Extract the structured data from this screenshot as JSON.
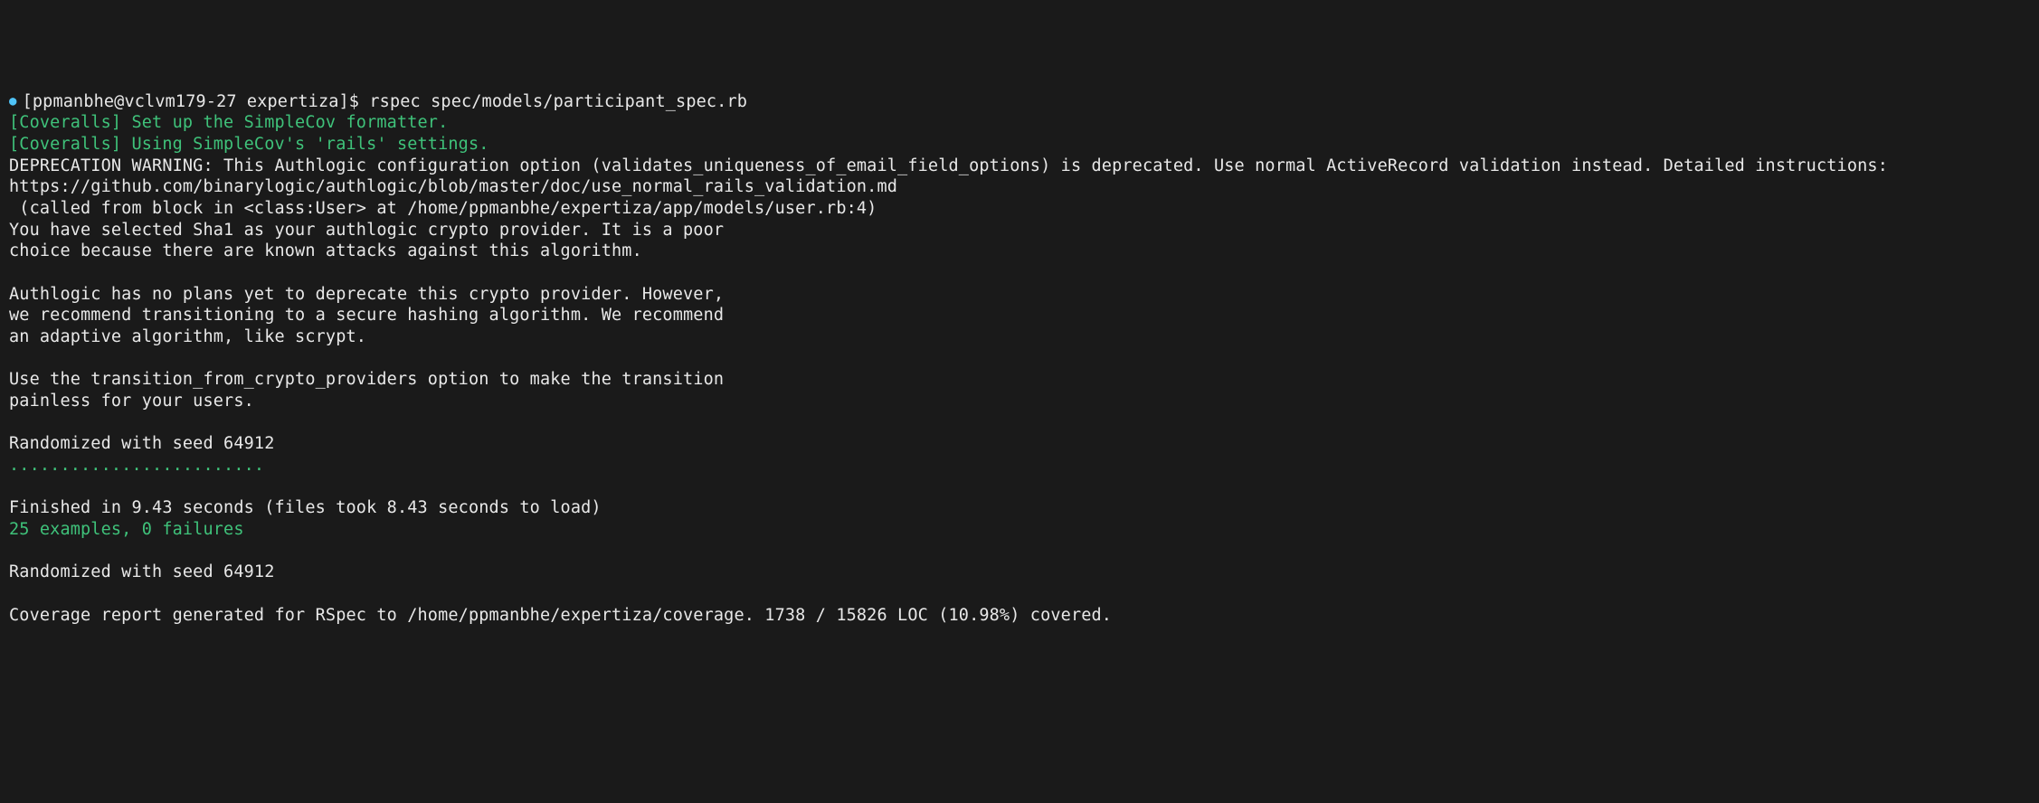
{
  "terminal": {
    "bullet": "●",
    "prompt": "[ppmanbhe@vclvm179-27 expertiza]$ ",
    "command": "rspec spec/models/participant_spec.rb",
    "lines": [
      {
        "cls": "green",
        "text": "[Coveralls] Set up the SimpleCov formatter."
      },
      {
        "cls": "green",
        "text": "[Coveralls] Using SimpleCov's 'rails' settings."
      },
      {
        "cls": "white",
        "text": "DEPRECATION WARNING: This Authlogic configuration option (validates_uniqueness_of_email_field_options) is deprecated. Use normal ActiveRecord validation instead. Detailed instructions:"
      },
      {
        "cls": "white",
        "text": "https://github.com/binarylogic/authlogic/blob/master/doc/use_normal_rails_validation.md"
      },
      {
        "cls": "white",
        "text": " (called from block in <class:User> at /home/ppmanbhe/expertiza/app/models/user.rb:4)"
      },
      {
        "cls": "white",
        "text": "You have selected Sha1 as your authlogic crypto provider. It is a poor"
      },
      {
        "cls": "white",
        "text": "choice because there are known attacks against this algorithm."
      },
      {
        "cls": "white",
        "text": ""
      },
      {
        "cls": "white",
        "text": "Authlogic has no plans yet to deprecate this crypto provider. However,"
      },
      {
        "cls": "white",
        "text": "we recommend transitioning to a secure hashing algorithm. We recommend"
      },
      {
        "cls": "white",
        "text": "an adaptive algorithm, like scrypt."
      },
      {
        "cls": "white",
        "text": ""
      },
      {
        "cls": "white",
        "text": "Use the transition_from_crypto_providers option to make the transition"
      },
      {
        "cls": "white",
        "text": "painless for your users."
      },
      {
        "cls": "white",
        "text": ""
      },
      {
        "cls": "white",
        "text": "Randomized with seed 64912"
      },
      {
        "cls": "green",
        "text": "........................."
      },
      {
        "cls": "white",
        "text": ""
      },
      {
        "cls": "white",
        "text": "Finished in 9.43 seconds (files took 8.43 seconds to load)"
      },
      {
        "cls": "green",
        "text": "25 examples, 0 failures"
      },
      {
        "cls": "white",
        "text": ""
      },
      {
        "cls": "white",
        "text": "Randomized with seed 64912"
      },
      {
        "cls": "white",
        "text": ""
      },
      {
        "cls": "white",
        "text": "Coverage report generated for RSpec to /home/ppmanbhe/expertiza/coverage. 1738 / 15826 LOC (10.98%) covered."
      }
    ]
  }
}
